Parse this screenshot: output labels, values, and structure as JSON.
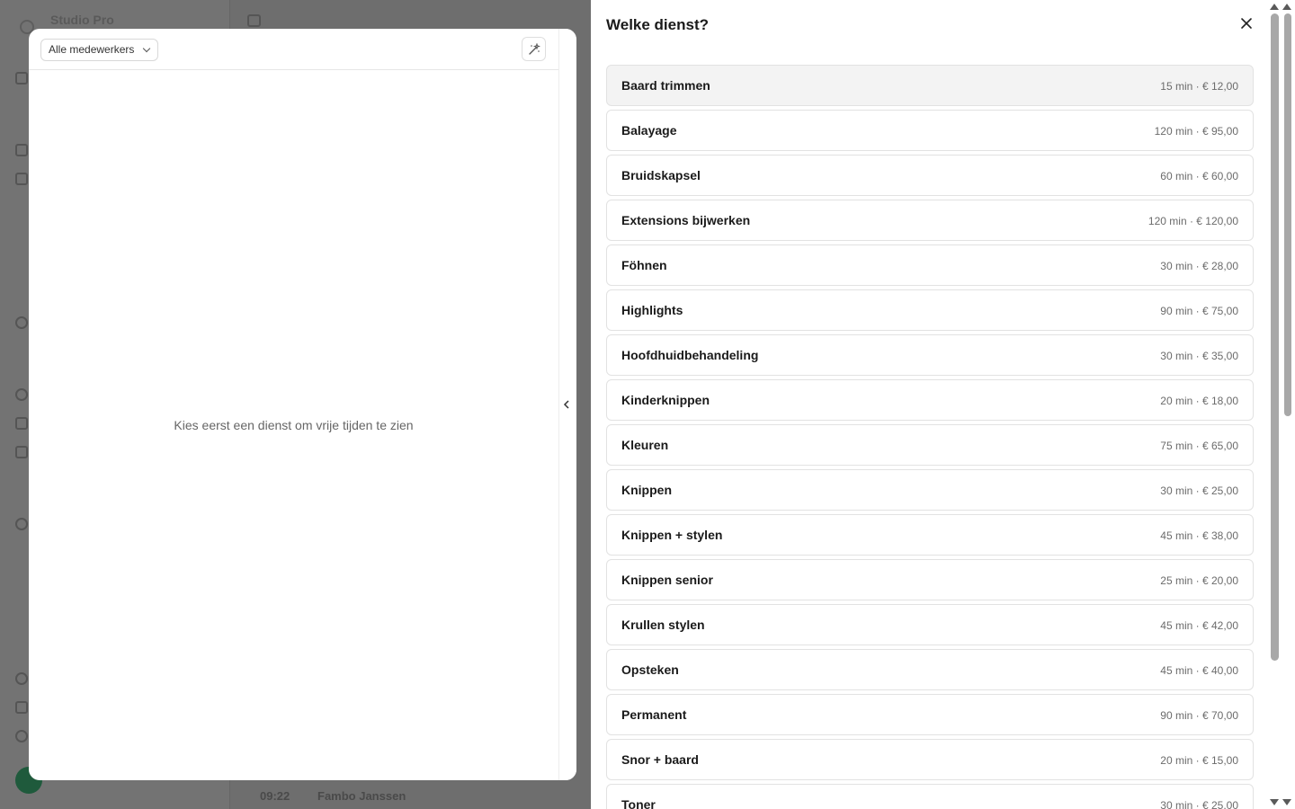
{
  "background": {
    "brand_name": "Studio Pro",
    "row_time": "09:22",
    "row_name": "Fambo Janssen"
  },
  "left_panel": {
    "staff_filter": {
      "selected": "Alle medewerkers",
      "icon": "chevron-down-icon"
    },
    "wand_icon": "magic-wand-icon",
    "empty_message": "Kies eerst een dienst om vrije tijden te zien",
    "collapse_icon": "chevron-left-icon"
  },
  "sheet": {
    "title": "Welke dienst?",
    "close_icon": "close-icon",
    "services": [
      {
        "name": "Baard trimmen",
        "meta": "15 min · € 12,00",
        "active": true
      },
      {
        "name": "Balayage",
        "meta": "120 min · € 95,00"
      },
      {
        "name": "Bruidskapsel",
        "meta": "60 min · € 60,00"
      },
      {
        "name": "Extensions bijwerken",
        "meta": "120 min · € 120,00"
      },
      {
        "name": "Föhnen",
        "meta": "30 min · € 28,00"
      },
      {
        "name": "Highlights",
        "meta": "90 min · € 75,00"
      },
      {
        "name": "Hoofdhuidbehandeling",
        "meta": "30 min · € 35,00"
      },
      {
        "name": "Kinderknippen",
        "meta": "20 min · € 18,00"
      },
      {
        "name": "Kleuren",
        "meta": "75 min · € 65,00"
      },
      {
        "name": "Knippen",
        "meta": "30 min · € 25,00"
      },
      {
        "name": "Knippen + stylen",
        "meta": "45 min · € 38,00"
      },
      {
        "name": "Knippen senior",
        "meta": "25 min · € 20,00"
      },
      {
        "name": "Krullen stylen",
        "meta": "45 min · € 42,00"
      },
      {
        "name": "Opsteken",
        "meta": "45 min · € 40,00"
      },
      {
        "name": "Permanent",
        "meta": "90 min · € 70,00"
      },
      {
        "name": "Snor + baard",
        "meta": "20 min · € 15,00"
      },
      {
        "name": "Toner",
        "meta": "30 min · € 25,00"
      }
    ]
  },
  "colors": {
    "overlay": "#6e6e6e",
    "active_item_bg": "#f3f3f3",
    "border": "#e2e2e2"
  }
}
